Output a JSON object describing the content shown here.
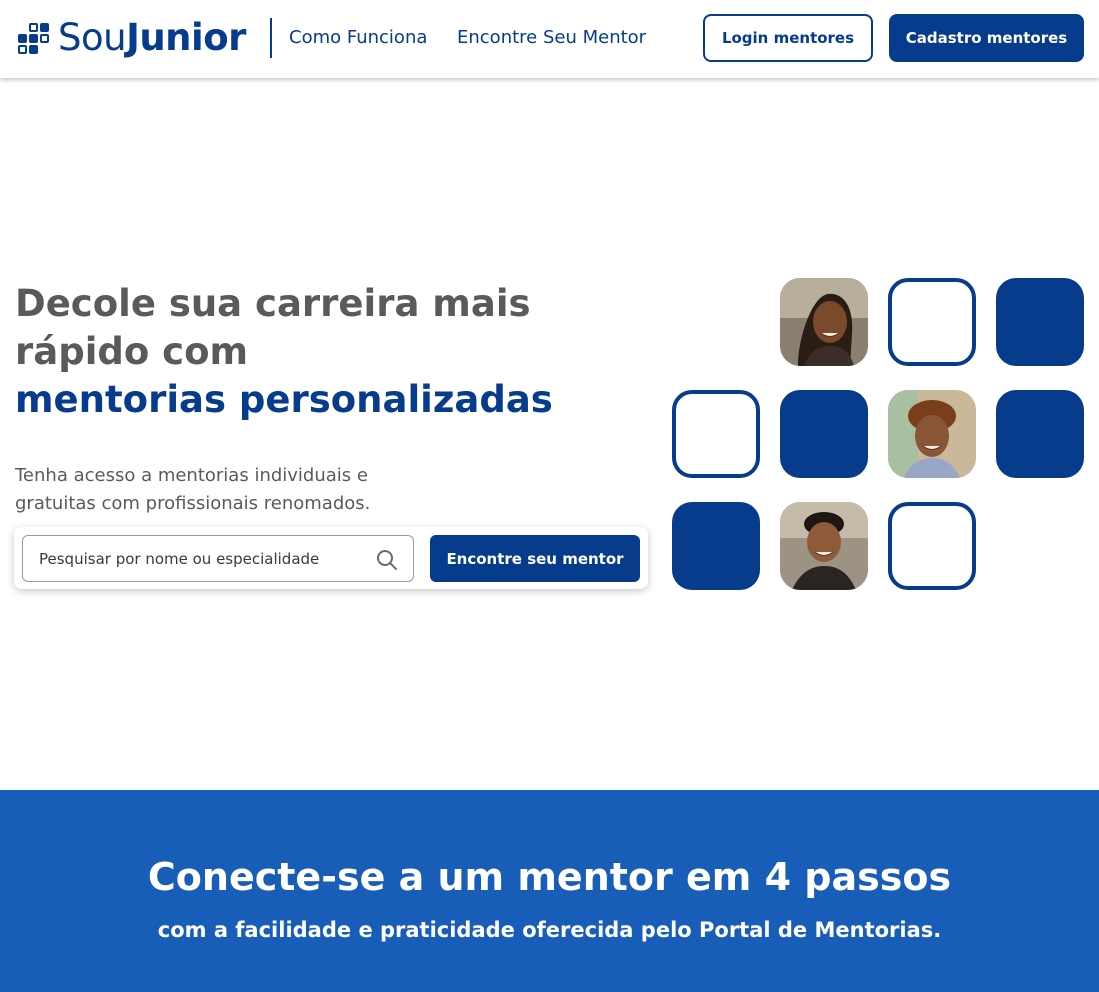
{
  "brand": {
    "name_light": "Sou",
    "name_bold": "Junior",
    "primary_color": "#063c8b",
    "band_color": "#185db8"
  },
  "nav": {
    "how_it_works": "Como Funciona",
    "find_mentor": "Encontre Seu Mentor",
    "login_label": "Login mentores",
    "signup_label": "Cadastro mentores"
  },
  "hero": {
    "title_line": "Decole sua carreira mais rápido com",
    "title_accent": "mentorias personalizadas",
    "subtitle": "Tenha acesso a mentorias individuais e gratuitas com profissionais renomados."
  },
  "search": {
    "placeholder": "Pesquisar por nome ou especialidade",
    "button_label": "Encontre seu mentor",
    "icon": "search-icon"
  },
  "tiles": [
    {
      "kind": "photo",
      "name": "mentor-photo-1"
    },
    {
      "kind": "outline"
    },
    {
      "kind": "solid"
    },
    {
      "kind": "outline"
    },
    {
      "kind": "solid"
    },
    {
      "kind": "photo",
      "name": "mentor-photo-2"
    },
    {
      "kind": "solid"
    },
    {
      "kind": "solid"
    },
    {
      "kind": "photo",
      "name": "mentor-photo-3"
    },
    {
      "kind": "outline"
    }
  ],
  "steps_section": {
    "title": "Conecte-se a um mentor em 4 passos",
    "subtitle": "com a facilidade e praticidade oferecida pelo Portal de Mentorias."
  }
}
